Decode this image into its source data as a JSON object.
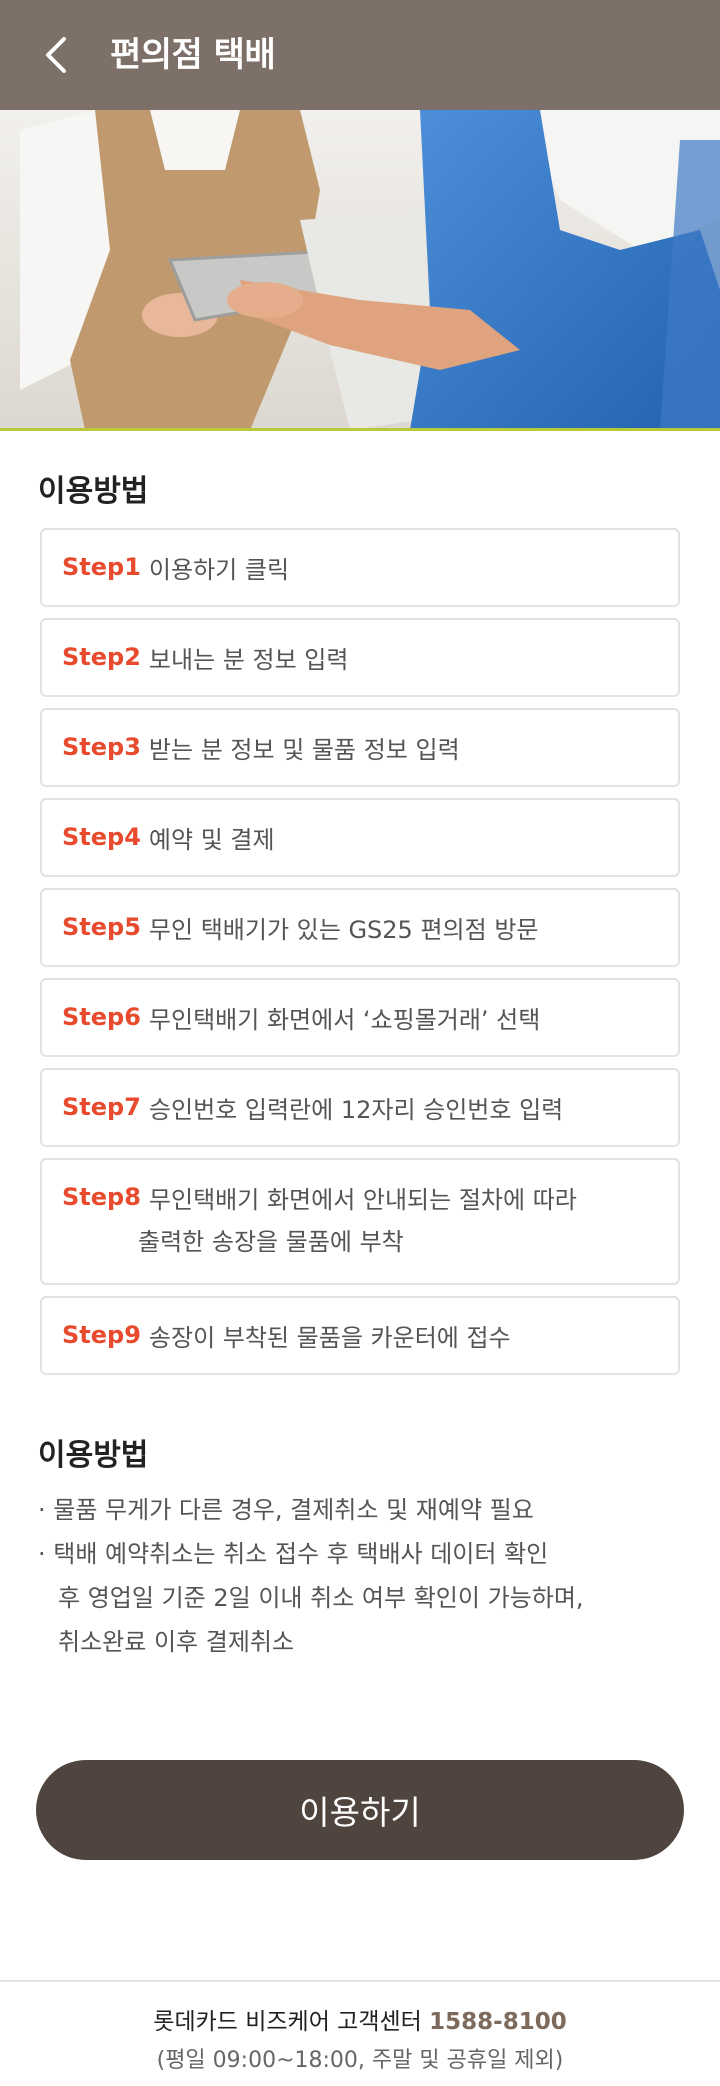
{
  "header": {
    "title": "편의점 택배",
    "back_icon": "chevron-left-icon"
  },
  "usage": {
    "title": "이용방법",
    "steps": [
      {
        "label": "Step1",
        "text": "이용하기 클릭"
      },
      {
        "label": "Step2",
        "text": "보내는 분 정보 입력"
      },
      {
        "label": "Step3",
        "text": "받는 분 정보 및 물품 정보 입력"
      },
      {
        "label": "Step4",
        "text": "예약 및 결제"
      },
      {
        "label": "Step5",
        "text": "무인 택배기가 있는 GS25 편의점 방문"
      },
      {
        "label": "Step6",
        "text": "무인택배기 화면에서 ‘쇼핑몰거래’ 선택"
      },
      {
        "label": "Step7",
        "text": "승인번호 입력란에 12자리 승인번호 입력"
      },
      {
        "label": "Step8",
        "text": "무인택배기 화면에서 안내되는 절차에 따라",
        "text2": "출력한 송장을 물품에 부착"
      },
      {
        "label": "Step9",
        "text": "송장이 부착된 물품을 카운터에 접수"
      }
    ]
  },
  "notes": {
    "title": "이용방법",
    "items": [
      "· 물품 무게가 다른 경우, 결제취소 및 재예약 필요",
      "· 택배 예약취소는 취소 접수 후 택배사 데이터 확인",
      "후 영업일 기준 2일 이내 취소 여부 확인이 가능하며,",
      "취소완료 이후 결제취소"
    ]
  },
  "cta": {
    "label": "이용하기"
  },
  "footer": {
    "center_label": "롯데카드 비즈케어 고객센터",
    "phone": "1588-8100",
    "hours": "(평일 09:00~18:00, 주말 및 공휴일 제외)"
  },
  "colors": {
    "header_bg": "#7d7068",
    "step_label": "#e84a2d",
    "button_bg": "#4f443e",
    "phone": "#7d6a5c"
  }
}
